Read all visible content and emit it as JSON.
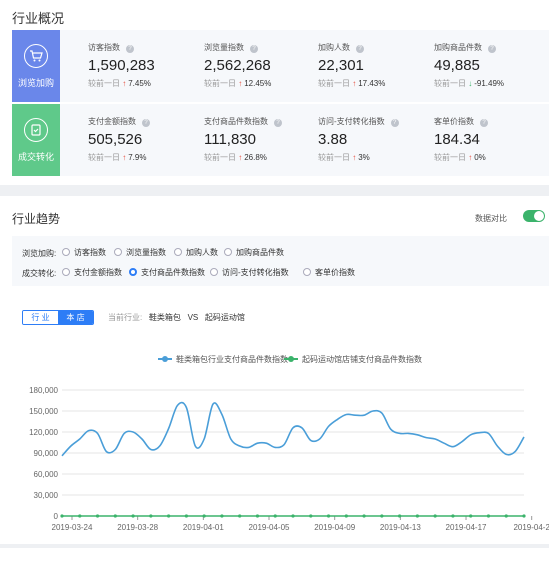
{
  "overview": {
    "title": "行业概况",
    "rows": [
      {
        "label": "浏览加购",
        "icon": "cart-icon",
        "metrics": [
          {
            "name": "访客指数",
            "value": "1,590,283",
            "cmp_label": "较前一日",
            "dir": "up",
            "pct": "7.45%"
          },
          {
            "name": "浏览量指数",
            "value": "2,562,268",
            "cmp_label": "较前一日",
            "dir": "up",
            "pct": "12.45%"
          },
          {
            "name": "加购人数",
            "value": "22,301",
            "cmp_label": "较前一日",
            "dir": "up",
            "pct": "17.43%"
          },
          {
            "name": "加购商品件数",
            "value": "49,885",
            "cmp_label": "较前一日",
            "dir": "down",
            "pct": "-91.49%"
          }
        ]
      },
      {
        "label": "成交转化",
        "icon": "clipboard-icon",
        "metrics": [
          {
            "name": "支付金额指数",
            "value": "505,526",
            "cmp_label": "较前一日",
            "dir": "up",
            "pct": "7.9%"
          },
          {
            "name": "支付商品件数指数",
            "value": "111,830",
            "cmp_label": "较前一日",
            "dir": "up",
            "pct": "26.8%"
          },
          {
            "name": "访问-支付转化指数",
            "value": "3.88",
            "cmp_label": "较前一日",
            "dir": "up",
            "pct": "3%"
          },
          {
            "name": "客单价指数",
            "value": "184.34",
            "cmp_label": "较前一日",
            "dir": "up",
            "pct": "0%"
          }
        ]
      }
    ]
  },
  "trend": {
    "title": "行业趋势",
    "compare_label": "数据对比",
    "compare_on": true,
    "filter_rows": [
      {
        "label": "浏览加购:",
        "options": [
          "访客指数",
          "浏览量指数",
          "加购人数",
          "加购商品件数"
        ]
      },
      {
        "label": "成交转化:",
        "options": [
          "支付金额指数",
          "支付商品件数指数",
          "访问-支付转化指数",
          "客单价指数"
        ]
      }
    ],
    "selected_option": "支付商品件数指数",
    "segments": [
      "行 业",
      "本 店"
    ],
    "active_segment": "本 店",
    "current_label": "当前行业:",
    "industry": "鞋类箱包",
    "vs": "VS",
    "shop": "起码运动馆"
  },
  "colors": {
    "accent": "#2d7df6",
    "series1": "#4a9ed8",
    "series2": "#3bb36b",
    "browse": "#6a87ea",
    "convert": "#5fc98a",
    "up": "#e64b3c",
    "down": "#3bb36b"
  },
  "chart_data": {
    "type": "line",
    "x_tick_labels": [
      "2019-03-24",
      "2019-03-28",
      "2019-04-01",
      "2019-04-05",
      "2019-04-09",
      "2019-04-13",
      "2019-04-17",
      "2019-04-2"
    ],
    "y_tick_labels": [
      "0",
      "30,000",
      "60,000",
      "90,000",
      "120,000",
      "150,000",
      "180,000"
    ],
    "ylim": [
      0,
      180000
    ],
    "series": [
      {
        "name": "鞋类箱包行业支付商品件数指数",
        "values": [
          86000,
          100000,
          110000,
          122000,
          118000,
          92000,
          95000,
          118000,
          120000,
          110000,
          95000,
          100000,
          125000,
          158000,
          155000,
          100000,
          110000,
          160000,
          145000,
          110000,
          100000,
          98000,
          104000,
          104000,
          98000,
          102000,
          126000,
          126000,
          108000,
          110000,
          128000,
          138000,
          145000,
          144000,
          144000,
          150000,
          147000,
          124000,
          118000,
          118000,
          116000,
          112000,
          110000,
          104000,
          99000,
          106000,
          116000,
          119000,
          118000,
          100000,
          88000,
          92000,
          113000
        ]
      },
      {
        "name": "起码运动馆店铺支付商品件数指数",
        "values": [
          0,
          0,
          0,
          0,
          0,
          0,
          0,
          0,
          0,
          0,
          0,
          0,
          0,
          0,
          0,
          0,
          0,
          0,
          0,
          0,
          0,
          0,
          0,
          0,
          0,
          0,
          0,
          0,
          0,
          0,
          0,
          0,
          0,
          0,
          0,
          0,
          0,
          0,
          0,
          0,
          0,
          0,
          0,
          0,
          0,
          0,
          0,
          0,
          0,
          0,
          0,
          0,
          0
        ]
      }
    ]
  }
}
